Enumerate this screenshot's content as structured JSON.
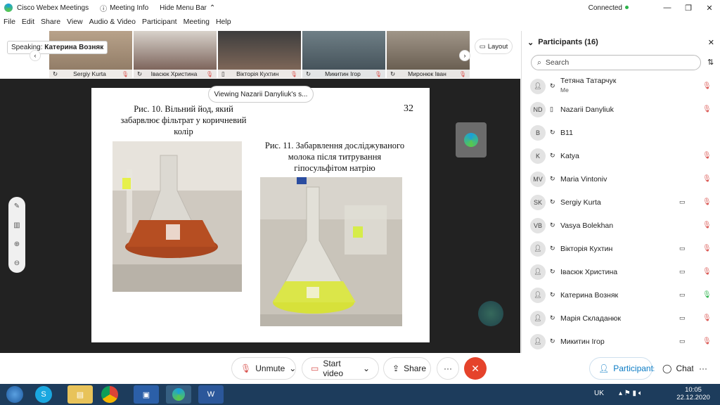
{
  "title_bar": {
    "app_name": "Cisco Webex Meetings",
    "meeting_info": "Meeting Info",
    "hide_menu_bar": "Hide Menu Bar",
    "status": "Connected"
  },
  "menu": [
    "File",
    "Edit",
    "Share",
    "View",
    "Audio & Video",
    "Participant",
    "Meeting",
    "Help"
  ],
  "speaking": {
    "label": "Speaking:",
    "name": "Катерина Возняк"
  },
  "thumbnails": [
    {
      "name": "Sergiy Kurta"
    },
    {
      "name": "Івасюк Христина"
    },
    {
      "name": "Вікторія Кухтин"
    },
    {
      "name": "Микитин Ігор"
    },
    {
      "name": "Миронюк Іван"
    }
  ],
  "layout_label": "Layout",
  "viewing_label": "Viewing Nazarii Danyliuk's s...",
  "slide": {
    "page_number": "32",
    "caption_left": "Рис. 10. Вільний  йод, який забарвлює фільтрат у коричневий колір",
    "caption_right": "Рис. 11. Забарвлення досліджуваного молока після титрування гіпосульфітом натрію"
  },
  "controls": {
    "unmute": "Unmute",
    "start_video": "Start video",
    "share": "Share",
    "participants": "Participants",
    "chat": "Chat"
  },
  "panel": {
    "title": "Participants (16)",
    "search_placeholder": "Search",
    "participants": [
      {
        "initials": "",
        "name": "Тетяна Татарчук",
        "sub": "Me",
        "video": false,
        "mic": "off"
      },
      {
        "initials": "ND",
        "name": "Nazarii Danyliuk",
        "sub": "",
        "video": false,
        "mic": "off"
      },
      {
        "initials": "B",
        "name": "B11",
        "sub": "",
        "video": false,
        "mic": "none"
      },
      {
        "initials": "K",
        "name": "Katya",
        "sub": "",
        "video": false,
        "mic": "off"
      },
      {
        "initials": "MV",
        "name": "Maria Vintoniv",
        "sub": "",
        "video": false,
        "mic": "off"
      },
      {
        "initials": "SK",
        "name": "Sergiy Kurta",
        "sub": "",
        "video": true,
        "mic": "off"
      },
      {
        "initials": "VB",
        "name": "Vasya Bolekhan",
        "sub": "",
        "video": false,
        "mic": "off"
      },
      {
        "initials": "",
        "name": "Вікторія Кухтин",
        "sub": "",
        "video": true,
        "mic": "off"
      },
      {
        "initials": "",
        "name": "Івасюк Христина",
        "sub": "",
        "video": true,
        "mic": "off"
      },
      {
        "initials": "",
        "name": "Катерина Возняк",
        "sub": "",
        "video": true,
        "mic": "on"
      },
      {
        "initials": "",
        "name": "Марія Складанюк",
        "sub": "",
        "video": true,
        "mic": "off"
      },
      {
        "initials": "",
        "name": "Микитин Ігор",
        "sub": "",
        "video": true,
        "mic": "off"
      }
    ]
  },
  "taskbar": {
    "lang": "UK",
    "time": "10:05",
    "date": "22.12.2020"
  },
  "colors": {
    "end_call": "#e5432b",
    "accent": "#0a7bc4",
    "mic_off": "#d9534f",
    "mic_on": "#2bb34b",
    "taskbar": "#1d3c5c"
  }
}
